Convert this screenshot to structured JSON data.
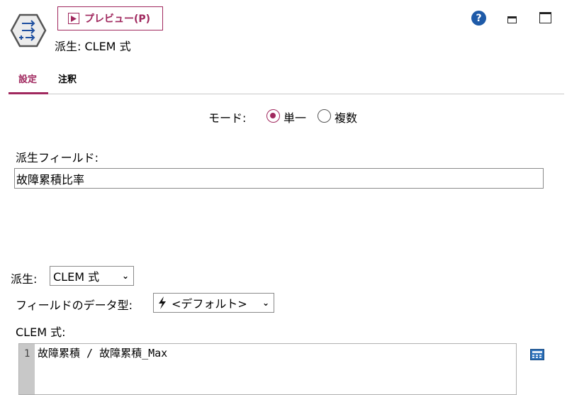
{
  "header": {
    "preview_label": "プレビュー(P)",
    "node_title": "派生: CLEM 式",
    "help_icon_glyph": "?",
    "accent_color": "#a0285e"
  },
  "tabs": [
    {
      "label": "設定",
      "active": true
    },
    {
      "label": "注釈",
      "active": false
    }
  ],
  "mode": {
    "label": "モード:",
    "options": [
      {
        "label": "単一",
        "checked": true
      },
      {
        "label": "複数",
        "checked": false
      }
    ]
  },
  "derive_field": {
    "label": "派生フィールド:",
    "value": "故障累積比率"
  },
  "derive_as": {
    "label": "派生:",
    "selected": "CLEM 式"
  },
  "field_type": {
    "label": "フィールドのデータ型:",
    "selected": "<デフォルト>"
  },
  "clem_expression": {
    "label": "CLEM 式:",
    "line_number": "1",
    "code": "故障累積 / 故障累積_Max"
  },
  "icons": {
    "node": "derive-node-icon",
    "play": "play-icon",
    "help": "help-icon",
    "minimize": "minimize-icon",
    "maximize": "maximize-icon",
    "bolt": "lightning-bolt-icon",
    "chevron": "chevron-down-icon",
    "calculator": "expression-builder-icon"
  }
}
